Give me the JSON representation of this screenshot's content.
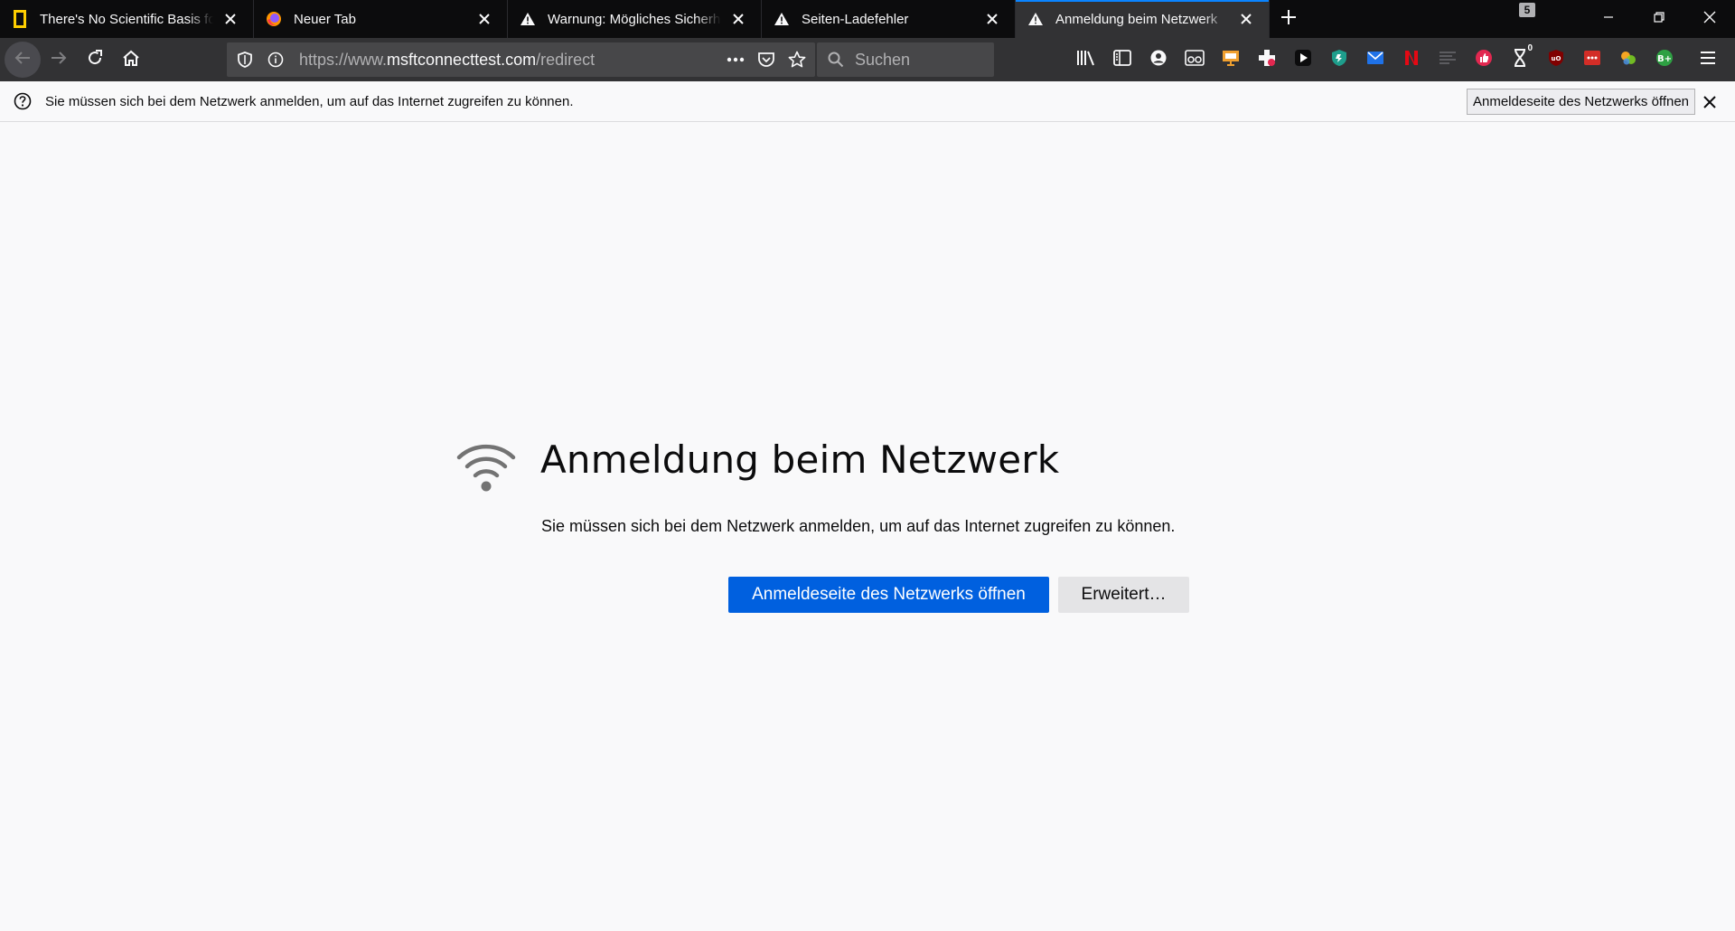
{
  "tabs": [
    {
      "title": "There's No Scientific Basis for Race—It's a Made-Up Label",
      "icon": "national-geographic-icon",
      "active": false
    },
    {
      "title": "Neuer Tab",
      "icon": "firefox-icon",
      "active": false
    },
    {
      "title": "Warnung: Mögliches Sicherheitsrisiko erkannt",
      "icon": "warning-icon",
      "active": false
    },
    {
      "title": "Seiten-Ladefehler",
      "icon": "warning-icon",
      "active": false
    },
    {
      "title": "Anmeldung beim Netzwerk",
      "icon": "warning-icon",
      "active": true
    }
  ],
  "tab_count": "5",
  "url": {
    "prefix": "https://www.",
    "domain": "msftconnecttest.com",
    "path": "/redirect"
  },
  "search": {
    "placeholder": "Suchen"
  },
  "extension_badge": "0",
  "notification": {
    "message": "Sie müssen sich bei dem Netzwerk anmelden, um auf das Internet zugreifen zu können.",
    "button_label": "Anmeldeseite des Netzwerks öffnen"
  },
  "page": {
    "title": "Anmeldung beim Netzwerk",
    "description": "Sie müssen sich bei dem Netzwerk anmelden, um auf das Internet zugreifen zu können.",
    "primary_button": "Anmeldeseite des Netzwerks öffnen",
    "secondary_button": "Erweitert…"
  },
  "colors": {
    "accent": "#0a84ff",
    "primary_button": "#0060df",
    "toolbar": "#323234",
    "tabstrip": "#0c0c0d"
  }
}
